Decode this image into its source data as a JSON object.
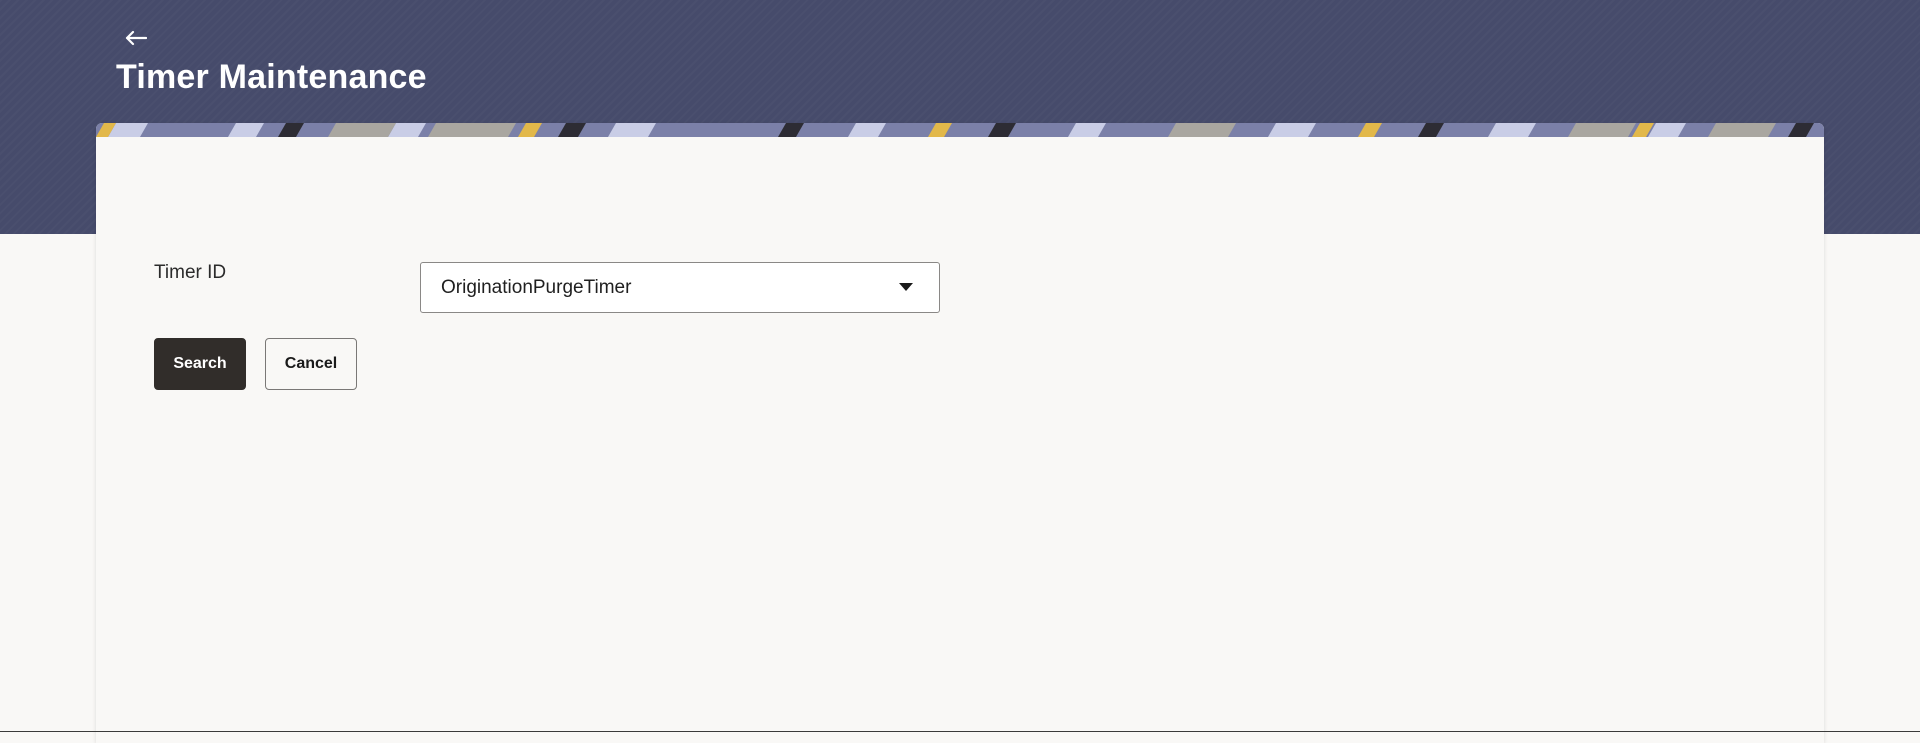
{
  "header": {
    "title": "Timer Maintenance",
    "back_icon": "arrow-left-icon"
  },
  "form": {
    "timer_id_label": "Timer ID",
    "timer_id_value": "OriginationPurgeTimer"
  },
  "actions": {
    "search_label": "Search",
    "cancel_label": "Cancel"
  },
  "colors": {
    "header_bg": "#464b6b",
    "primary_button": "#312d2a",
    "page_bg": "#f9f8f6"
  }
}
